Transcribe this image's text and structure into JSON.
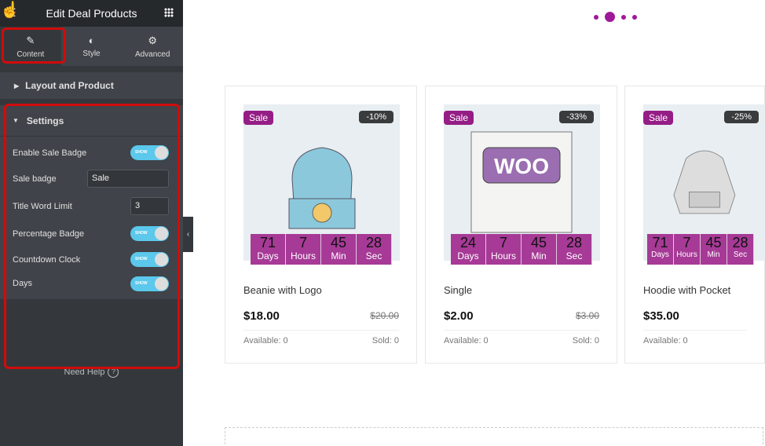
{
  "panel": {
    "title": "Edit Deal Products",
    "tabs": [
      {
        "label": "Content"
      },
      {
        "label": "Style"
      },
      {
        "label": "Advanced"
      }
    ],
    "sections": {
      "layout": "Layout and Product",
      "settings": "Settings"
    },
    "settings": {
      "enable_sale_badge": {
        "label": "Enable Sale Badge",
        "toggle": "SHOW"
      },
      "sale_badge": {
        "label": "Sale badge",
        "value": "Sale"
      },
      "title_word_limit": {
        "label": "Title Word Limit",
        "value": "3"
      },
      "percentage_badge": {
        "label": "Percentage Badge",
        "toggle": "SHOW"
      },
      "countdown_clock": {
        "label": "Countdown Clock",
        "toggle": "SHOW"
      },
      "days": {
        "label": "Days",
        "toggle": "SHOW"
      }
    },
    "help": "Need Help",
    "help_icon": "?"
  },
  "carousel": {
    "active_dot": 1
  },
  "products": [
    {
      "sale": "Sale",
      "pct": "-10%",
      "cd": [
        "71",
        "7",
        "45",
        "28"
      ],
      "title": "Beanie with Logo",
      "price": "$18.00",
      "old": "$20.00",
      "available": "Available: 0",
      "sold": "Sold: 0"
    },
    {
      "sale": "Sale",
      "pct": "-33%",
      "cd": [
        "24",
        "7",
        "45",
        "28"
      ],
      "title": "Single",
      "price": "$2.00",
      "old": "$3.00",
      "available": "Available: 0",
      "sold": "Sold: 0"
    },
    {
      "sale": "Sale",
      "pct": "-25%",
      "cd": [
        "71",
        "7",
        "45",
        "28"
      ],
      "title": "Hoodie with Pocket",
      "price": "$35.00",
      "old": "",
      "available": "Available: 0",
      "sold": ""
    }
  ],
  "cd_labels": [
    "Days",
    "Hours",
    "Min",
    "Sec"
  ],
  "colors": {
    "accent": "#951d86",
    "countdown": "#a63a96",
    "toggle": "#5bc8ec",
    "highlight": "#d10b0b"
  }
}
